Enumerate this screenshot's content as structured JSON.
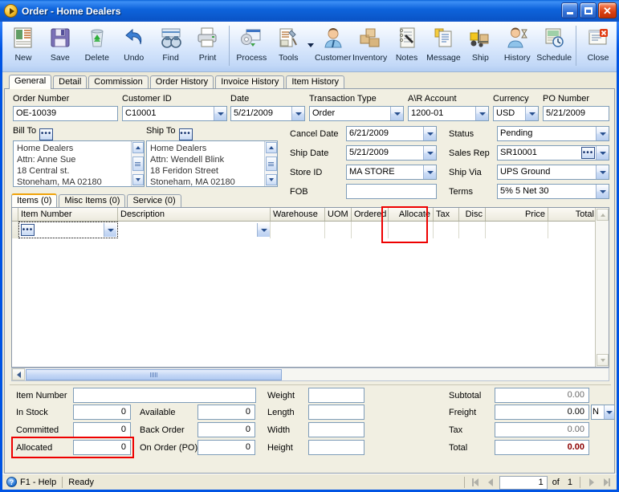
{
  "window": {
    "title": "Order  - Home Dealers",
    "icon": "order-app-icon",
    "minimize_label": "Minimize",
    "maximize_label": "Maximize",
    "close_label": "Close"
  },
  "toolbar": {
    "items": [
      {
        "label": "New",
        "icon": "new-document-icon"
      },
      {
        "label": "Save",
        "icon": "floppy-disk-icon"
      },
      {
        "label": "Delete",
        "icon": "recycle-bin-icon"
      },
      {
        "label": "Undo",
        "icon": "undo-arrow-icon"
      },
      {
        "label": "Find",
        "icon": "binoculars-icon"
      },
      {
        "label": "Print",
        "icon": "printer-icon"
      },
      {
        "label": "Process",
        "icon": "process-gear-icon"
      },
      {
        "label": "Tools",
        "icon": "tools-wrench-icon"
      },
      {
        "label": "Customer",
        "icon": "customer-person-icon"
      },
      {
        "label": "Inventory",
        "icon": "inventory-boxes-icon"
      },
      {
        "label": "Notes",
        "icon": "notepad-pen-icon"
      },
      {
        "label": "Message",
        "icon": "message-note-icon"
      },
      {
        "label": "Ship",
        "icon": "forklift-ship-icon"
      },
      {
        "label": "History",
        "icon": "history-hourglass-icon"
      },
      {
        "label": "Schedule",
        "icon": "schedule-calendar-icon"
      },
      {
        "label": "Close",
        "icon": "close-window-icon"
      }
    ]
  },
  "tabs": [
    {
      "label": "General",
      "active": true
    },
    {
      "label": "Detail",
      "active": false
    },
    {
      "label": "Commission",
      "active": false
    },
    {
      "label": "Order History",
      "active": false
    },
    {
      "label": "Invoice History",
      "active": false
    },
    {
      "label": "Item History",
      "active": false
    }
  ],
  "header_fields": {
    "order_number": {
      "label": "Order Number",
      "value": "OE-10039"
    },
    "customer_id": {
      "label": "Customer ID",
      "value": "C10001"
    },
    "date": {
      "label": "Date",
      "value": "5/21/2009"
    },
    "transaction_type": {
      "label": "Transaction Type",
      "value": "Order"
    },
    "ar_account": {
      "label": "A\\R Account",
      "value": "1200-01"
    },
    "currency": {
      "label": "Currency",
      "value": "USD"
    },
    "po_number": {
      "label": "PO Number",
      "value": "5/21/2009"
    }
  },
  "addresses": {
    "bill_to": {
      "label": "Bill To",
      "lines": [
        "Home Dealers",
        "Attn: Anne Sue",
        "18 Central st.",
        "Stoneham, MA 02180"
      ]
    },
    "ship_to": {
      "label": "Ship To",
      "lines": [
        "Home Dealers",
        "Attn: Wendell Blink",
        "18 Feridon Street",
        "Stoneham, MA 02180"
      ]
    }
  },
  "order_details": {
    "cancel_date": {
      "label": "Cancel  Date",
      "value": "6/21/2009"
    },
    "ship_date": {
      "label": "Ship Date",
      "value": "5/21/2009"
    },
    "store_id": {
      "label": "Store ID",
      "value": "MA STORE"
    },
    "fob": {
      "label": "FOB",
      "value": ""
    },
    "status": {
      "label": "Status",
      "value": "Pending"
    },
    "sales_rep": {
      "label": "Sales Rep",
      "value": "SR10001"
    },
    "ship_via": {
      "label": "Ship Via",
      "value": "UPS Ground"
    },
    "terms": {
      "label": "Terms",
      "value": "5% 5 Net 30"
    }
  },
  "line_tabs": [
    {
      "label": "Items (0)",
      "active": true
    },
    {
      "label": "Misc Items (0)",
      "active": false
    },
    {
      "label": "Service (0)",
      "active": false
    }
  ],
  "grid": {
    "columns": [
      {
        "label": "Item Number",
        "align": "left"
      },
      {
        "label": "Description",
        "align": "left"
      },
      {
        "label": "Warehouse",
        "align": "left"
      },
      {
        "label": "UOM",
        "align": "left"
      },
      {
        "label": "Ordered",
        "align": "right"
      },
      {
        "label": "Allocate",
        "align": "right"
      },
      {
        "label": "Tax",
        "align": "left"
      },
      {
        "label": "Disc",
        "align": "right"
      },
      {
        "label": "Price",
        "align": "right"
      },
      {
        "label": "Total",
        "align": "right"
      }
    ],
    "rows": [
      {
        "item_number": "",
        "description": "",
        "warehouse": "",
        "uom": "",
        "ordered": "",
        "allocate": "",
        "tax": "",
        "disc": "",
        "price": "",
        "total": ""
      }
    ]
  },
  "item_info": {
    "item_number": {
      "label": "Item Number",
      "value": ""
    },
    "in_stock": {
      "label": "In Stock",
      "value": "0"
    },
    "committed": {
      "label": "Committed",
      "value": "0"
    },
    "allocated": {
      "label": "Allocated",
      "value": "0"
    },
    "available": {
      "label": "Available",
      "value": "0"
    },
    "back_order": {
      "label": "Back Order",
      "value": "0"
    },
    "on_order_po": {
      "label": "On Order (PO)",
      "value": "0"
    },
    "weight": {
      "label": "Weight",
      "value": ""
    },
    "length": {
      "label": "Length",
      "value": ""
    },
    "width": {
      "label": "Width",
      "value": ""
    },
    "height": {
      "label": "Height",
      "value": ""
    }
  },
  "totals": {
    "subtotal": {
      "label": "Subtotal",
      "value": "0.00"
    },
    "freight": {
      "label": "Freight",
      "value": "0.00",
      "taxable": "N"
    },
    "tax": {
      "label": "Tax",
      "value": "0.00"
    },
    "total": {
      "label": "Total",
      "value": "0.00",
      "color": "#8b0000"
    }
  },
  "statusbar": {
    "help": "F1 - Help",
    "state": "Ready",
    "record": "1",
    "of_label": "of",
    "record_count": "1"
  },
  "annotations": [
    {
      "name": "allocate-column-highlight",
      "color": "#ee0000"
    },
    {
      "name": "allocated-field-highlight",
      "color": "#ee0000"
    }
  ]
}
